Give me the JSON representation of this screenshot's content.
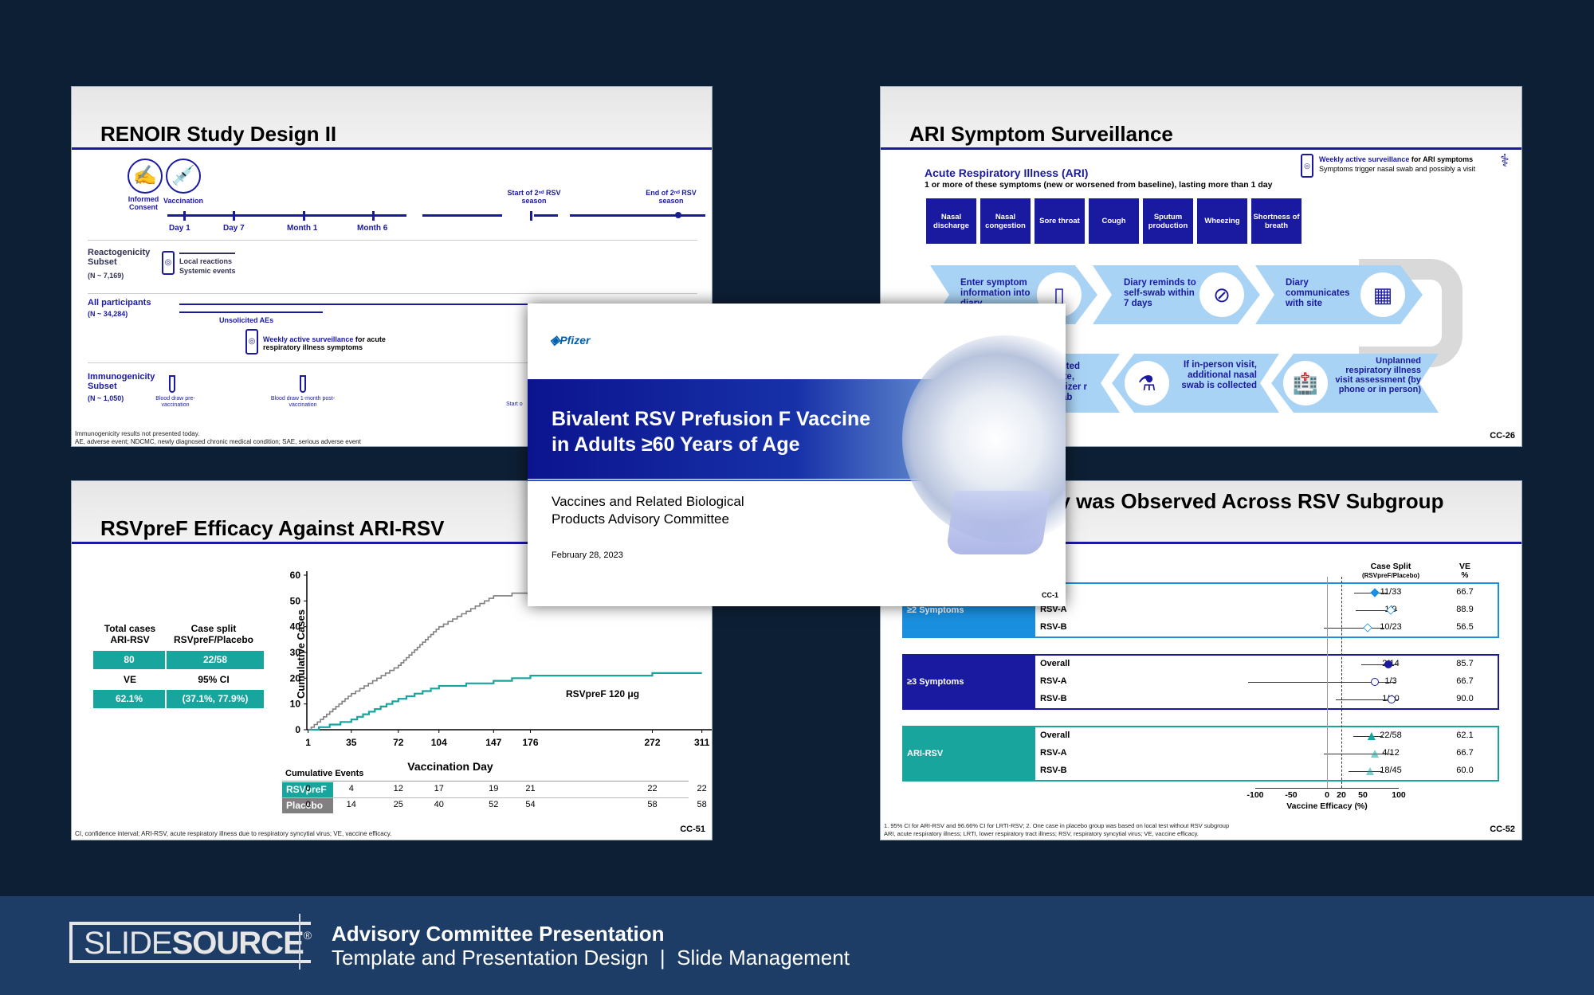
{
  "slide1": {
    "title": "RENOIR Study Design II",
    "icon1": "Informed Consent",
    "icon2": "Vaccination",
    "tl": [
      "Day 1",
      "Day 7",
      "Month 1",
      "Month 6"
    ],
    "start2": "Start of 2ⁿᵈ RSV season",
    "end2": "End of 2ⁿᵈ RSV season",
    "reacto": "Reactogenicity Subset",
    "reacto_n": "(N ~ 7,169)",
    "local": "Local reactions",
    "systemic": "Systemic events",
    "allp": "All participants",
    "allp_n": "(N ~ 34,284)",
    "unsol": "Unsolicited AEs",
    "weekly_b": "Weekly active surveillance",
    "weekly_r": " for acute respiratory illness symptoms",
    "immuno": "Immunogenicity Subset",
    "immuno_n": "(N ~ 1,050)",
    "bd1": "Blood draw pre-vaccination",
    "bd2": "Blood draw 1-month post-vaccination",
    "bd3": "Start o",
    "foot1": "Immunogenicity results not presented today.",
    "foot2": "AE, adverse event; NDCMC, newly diagnosed chronic medical condition; SAE, serious adverse event"
  },
  "slide2": {
    "title": "ARI Symptom Surveillance",
    "ari": "Acute Respiratory Illness (ARI)",
    "ari_sub": "1 or more of these symptoms (new or worsened from baseline), lasting more than 1 day",
    "weekly_b": "Weekly active surveillance",
    "weekly_r": " for ARI symptoms",
    "weekly2": "Symptoms trigger nasal swab and possibly a visit",
    "symptoms": [
      "Nasal discharge",
      "Nasal congestion",
      "Sore throat",
      "Cough",
      "Sputum production",
      "Wheezing",
      "Shortness of breath"
    ],
    "flow": [
      "Enter symptom information into diary",
      "Diary reminds to self-swab within 7 days",
      "Diary communicates with site",
      "Unplanned respiratory illness visit assessment (by phone or in person)",
      "If in-person visit, additional nasal swab is collected",
      "ected site, Pfizer r Lab"
    ],
    "num": "CC-26",
    "icons": [
      "phone-icon",
      "swab-icon",
      "calendar-icon",
      "hospital-icon",
      "tube-icon"
    ]
  },
  "slide3": {
    "title": "RSVpreF Efficacy Against ARI-RSV",
    "h1": "Total cases ARI-RSV",
    "h2": "Case split RSVpreF/Placebo",
    "v1": "80",
    "v2": "22/58",
    "h3": "VE",
    "h4": "95% CI",
    "v3": "62.1%",
    "v4": "(37.1%, 77.9%)",
    "ylabel": "Cumulative Cases",
    "xlabel": "Vaccination Day",
    "series_label": "RSVpreF 120 μg",
    "ev_title": "Cumulative Events",
    "rows": [
      {
        "name": "RSVpreF",
        "values": [
          "0",
          "4",
          "12",
          "17",
          "19",
          "21",
          "22",
          "22"
        ]
      },
      {
        "name": "Placebo",
        "values": [
          "0",
          "14",
          "25",
          "40",
          "52",
          "54",
          "58",
          "58"
        ]
      }
    ],
    "foot": "CI, confidence interval; ARI-RSV, acute respiratory illness due to respiratory syncytial virus; VE, vaccine efficacy.",
    "num": "CC-51"
  },
  "slide4": {
    "title": "cacy was Observed Across RSV Subgroup",
    "hcs": "Case Split",
    "hcs2": "(RSVpreF/Placebo)",
    "hve": "VE",
    "hve2": "%",
    "cc1": "CC-1",
    "groups": [
      {
        "name": "≥2 Symptoms",
        "rows": [
          {
            "label": "rall",
            "cs": "11/33",
            "ve": "66.7"
          },
          {
            "label": "RSV-A",
            "cs": "1/9",
            "ve": "88.9"
          },
          {
            "label": "RSV-B",
            "cs": "10/23",
            "ve": "56.5"
          }
        ]
      },
      {
        "name": "≥3 Symptoms",
        "rows": [
          {
            "label": "Overall",
            "cs": "2/14",
            "ve": "85.7"
          },
          {
            "label": "RSV-A",
            "cs": "1/3",
            "ve": "66.7"
          },
          {
            "label": "RSV-B",
            "cs": "1/10",
            "ve": "90.0"
          }
        ]
      },
      {
        "name": "ARI-RSV",
        "rows": [
          {
            "label": "Overall",
            "cs": "22/58",
            "ve": "62.1"
          },
          {
            "label": "RSV-A",
            "cs": "4/12",
            "ve": "66.7"
          },
          {
            "label": "RSV-B",
            "cs": "18/45",
            "ve": "60.0"
          }
        ]
      }
    ],
    "xticks": [
      "-100",
      "-50",
      "0",
      "20",
      "50",
      "100"
    ],
    "xlabel": "Vaccine Efficacy (%)",
    "foot1": "1. 95% CI for ARI-RSV and 96.66% CI for LRTI-RSV; 2. One case in placebo group was based on local test without RSV subgroup",
    "foot2": "ARI, acute respiratory illness; LRTI, lower respiratory tract illness; RSV, respiratory syncytial virus; VE, vaccine efficacy.",
    "num": "CC-52"
  },
  "cover": {
    "logo": "Pfizer",
    "title1": "Bivalent RSV Prefusion F Vaccine",
    "title2": "in Adults ≥60 Years of Age",
    "sub1": "Vaccines and Related Biological",
    "sub2": "Products Advisory Committee",
    "date": "February 28, 2023"
  },
  "banner": {
    "logo1": "SLIDE",
    "logo2": "SOURCE",
    "reg": "®",
    "line1": "Advisory Committee Presentation",
    "line2": "Template and Presentation Design  |  Slide Management"
  },
  "colors": {
    "navy": "#1a1aa0",
    "teal": "#17a59e",
    "bg": "#0d1f35",
    "banner": "#1d3c66"
  },
  "chart_data": {
    "type": "line",
    "x": [
      1,
      35,
      72,
      104,
      147,
      176,
      272,
      311
    ],
    "series": [
      {
        "name": "RSVpreF",
        "values": [
          0,
          4,
          12,
          17,
          19,
          21,
          22,
          22
        ]
      },
      {
        "name": "Placebo",
        "values": [
          0,
          14,
          25,
          40,
          52,
          54,
          58,
          58
        ]
      }
    ],
    "xlabel": "Vaccination Day",
    "ylabel": "Cumulative Cases",
    "ylim": [
      0,
      60
    ],
    "yticks": [
      0,
      10,
      20,
      30,
      40,
      50,
      60
    ],
    "xticks": [
      1,
      35,
      72,
      104,
      147,
      176,
      272,
      311
    ]
  }
}
